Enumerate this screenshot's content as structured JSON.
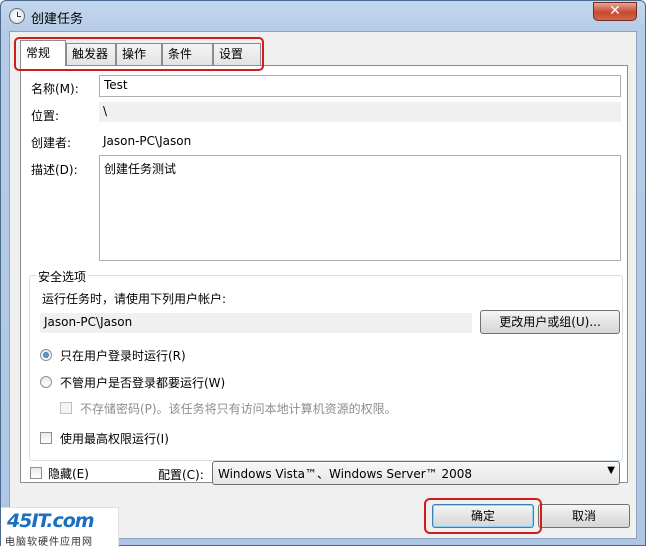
{
  "window": {
    "title": "创建任务",
    "close_glyph": "✕"
  },
  "tabs": [
    {
      "label": "常规",
      "active": true
    },
    {
      "label": "触发器",
      "active": false
    },
    {
      "label": "操作",
      "active": false
    },
    {
      "label": "条件",
      "active": false
    },
    {
      "label": "设置",
      "active": false
    }
  ],
  "general": {
    "name_label": "名称(M):",
    "name_value": "Test",
    "location_label": "位置:",
    "location_value": "\\",
    "author_label": "创建者:",
    "author_value": "Jason-PC\\Jason",
    "description_label": "描述(D):",
    "description_value": "创建任务测试"
  },
  "security": {
    "title": "安全选项",
    "run_as_label": "运行任务时，请使用下列用户帐户:",
    "user_account": "Jason-PC\\Jason",
    "change_user_button": "更改用户或组(U)...",
    "radio_logged_on": "只在用户登录时运行(R)",
    "radio_always": "不管用户是否登录都要运行(W)",
    "no_store_password": "不存储密码(P)。该任务将只有访问本地计算机资源的权限。",
    "highest_privileges": "使用最高权限运行(I)"
  },
  "bottom": {
    "hidden_label": "隐藏(E)",
    "configure_label": "配置(C):",
    "configure_value": "Windows Vista™、Windows Server™ 2008",
    "ok_button": "确定",
    "cancel_button": "取消"
  },
  "watermark": {
    "logo": "45IT.com",
    "subtitle": "电脑软硬件应用网"
  },
  "colors": {
    "highlight": "#d01c1c",
    "titlebar": "#b6cbe6",
    "radio_dot": "#1c5e9c"
  }
}
